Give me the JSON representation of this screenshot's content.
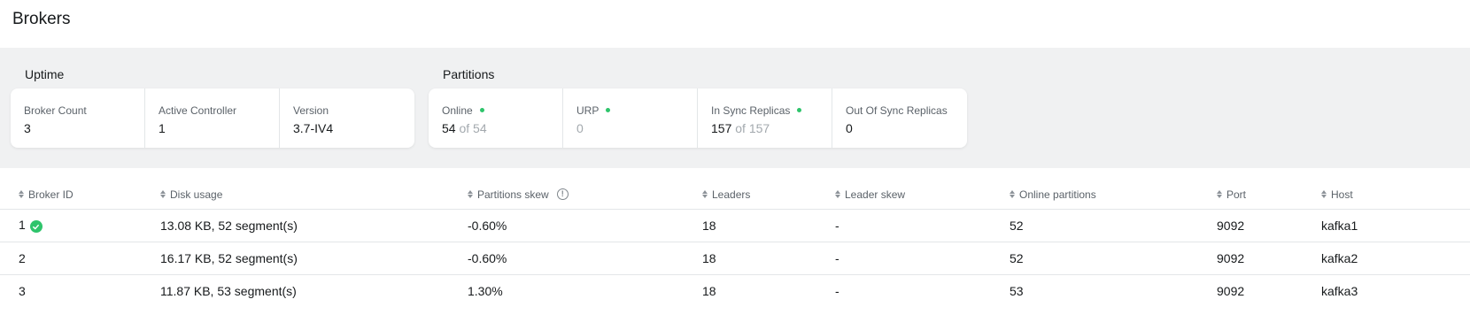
{
  "page": {
    "title": "Brokers"
  },
  "metrics": {
    "uptime": {
      "title": "Uptime",
      "cards": [
        {
          "label": "Broker Count",
          "value": "3"
        },
        {
          "label": "Active Controller",
          "value": "1"
        },
        {
          "label": "Version",
          "value": "3.7-IV4"
        }
      ]
    },
    "partitions": {
      "title": "Partitions",
      "cards": [
        {
          "label": "Online",
          "value": "54",
          "of": "of 54",
          "status": "ok"
        },
        {
          "label": "URP",
          "value": "0",
          "status": "ok"
        },
        {
          "label": "In Sync Replicas",
          "value": "157",
          "of": "of 157",
          "status": "ok"
        },
        {
          "label": "Out Of Sync Replicas",
          "value": "0"
        }
      ]
    }
  },
  "table": {
    "columns": [
      "Broker ID",
      "Disk usage",
      "Partitions skew",
      "Leaders",
      "Leader skew",
      "Online partitions",
      "Port",
      "Host"
    ],
    "rows": [
      {
        "broker_id": "1",
        "controller": true,
        "disk_usage": "13.08 KB, 52 segment(s)",
        "partitions_skew": "-0.60%",
        "leaders": "18",
        "leader_skew": "-",
        "online_partitions": "52",
        "port": "9092",
        "host": "kafka1"
      },
      {
        "broker_id": "2",
        "controller": false,
        "disk_usage": "16.17 KB, 52 segment(s)",
        "partitions_skew": "-0.60%",
        "leaders": "18",
        "leader_skew": "-",
        "online_partitions": "52",
        "port": "9092",
        "host": "kafka2"
      },
      {
        "broker_id": "3",
        "controller": false,
        "disk_usage": "11.87 KB, 53 segment(s)",
        "partitions_skew": "1.30%",
        "leaders": "18",
        "leader_skew": "-",
        "online_partitions": "53",
        "port": "9092",
        "host": "kafka3"
      }
    ]
  },
  "icons": {
    "sort": "sort-icon",
    "info": "info-icon",
    "status_dot": "status-dot-icon",
    "controller": "check-circle-icon"
  },
  "colors": {
    "accent_green": "#2ec46b",
    "metrics_bg": "#f0f1f2",
    "muted_text": "#a3a9ae"
  }
}
